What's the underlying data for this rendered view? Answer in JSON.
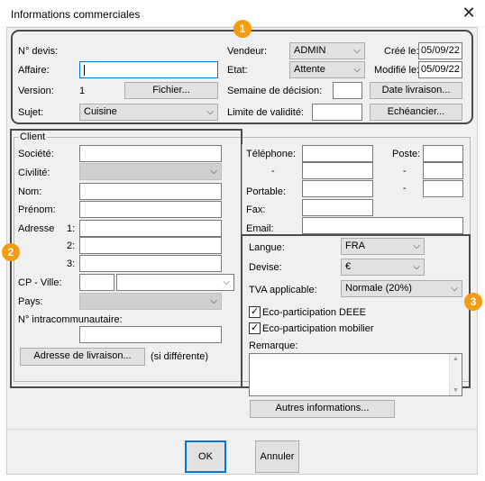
{
  "window": {
    "title": "Informations commerciales",
    "close_glyph": "✕"
  },
  "badges": [
    "1",
    "2",
    "3"
  ],
  "devis": {
    "numero_label": "N° devis:",
    "affaire_label": "Affaire:",
    "affaire_value": "",
    "version_label": "Version:",
    "version_value": "1",
    "fichier_button": "Fichier...",
    "sujet_label": "Sujet:",
    "sujet_value": "Cuisine",
    "vendeur_label": "Vendeur:",
    "vendeur_value": "ADMIN",
    "etat_label": "Etat:",
    "etat_value": "Attente",
    "semaine_label": "Semaine de décision:",
    "semaine_value": "",
    "limite_label": "Limite de validité:",
    "limite_value": "",
    "cree_label": "Créé le:",
    "cree_value": "05/09/22",
    "modifie_label": "Modifié le:",
    "modifie_value": "05/09/22",
    "date_livraison_button": "Date livraison...",
    "echeancier_button": "Echéancier..."
  },
  "client": {
    "legend": "Client",
    "societe_label": "Société:",
    "civilite_label": "Civilité:",
    "nom_label": "Nom:",
    "prenom_label": "Prénom:",
    "adresse_label": "Adresse",
    "adresse_line1": "1:",
    "adresse_line2": "2:",
    "adresse_line3": "3:",
    "cp_ville_label": "CP - Ville:",
    "pays_label": "Pays:",
    "intracom_label": "N° intracommunautaire:",
    "adresse_livraison_button": "Adresse de livraison...",
    "si_differente": "(si différente)",
    "telephone_label": "Téléphone:",
    "poste_label": "Poste:",
    "dash": "-",
    "portable_label": "Portable:",
    "fax_label": "Fax:",
    "email_label": "Email:"
  },
  "options": {
    "langue_label": "Langue:",
    "langue_value": "FRA",
    "devise_label": "Devise:",
    "devise_value": "€",
    "tva_label": "TVA applicable:",
    "tva_value": "Normale (20%)",
    "eco_deee_label": "Eco-participation DEEE",
    "eco_deee_checked": true,
    "eco_mobilier_label": "Eco-participation mobilier",
    "eco_mobilier_checked": true,
    "remarque_label": "Remarque:",
    "autres_button": "Autres informations..."
  },
  "footer": {
    "ok_button": "OK",
    "annuler_button": "Annuler"
  },
  "colors": {
    "badge": "#f39c12",
    "group_border": "#4a4a4a",
    "focus": "#0078d7"
  },
  "icons": {
    "close": "close-icon",
    "dropdown": "chevron-down-icon",
    "check": "check-icon"
  }
}
